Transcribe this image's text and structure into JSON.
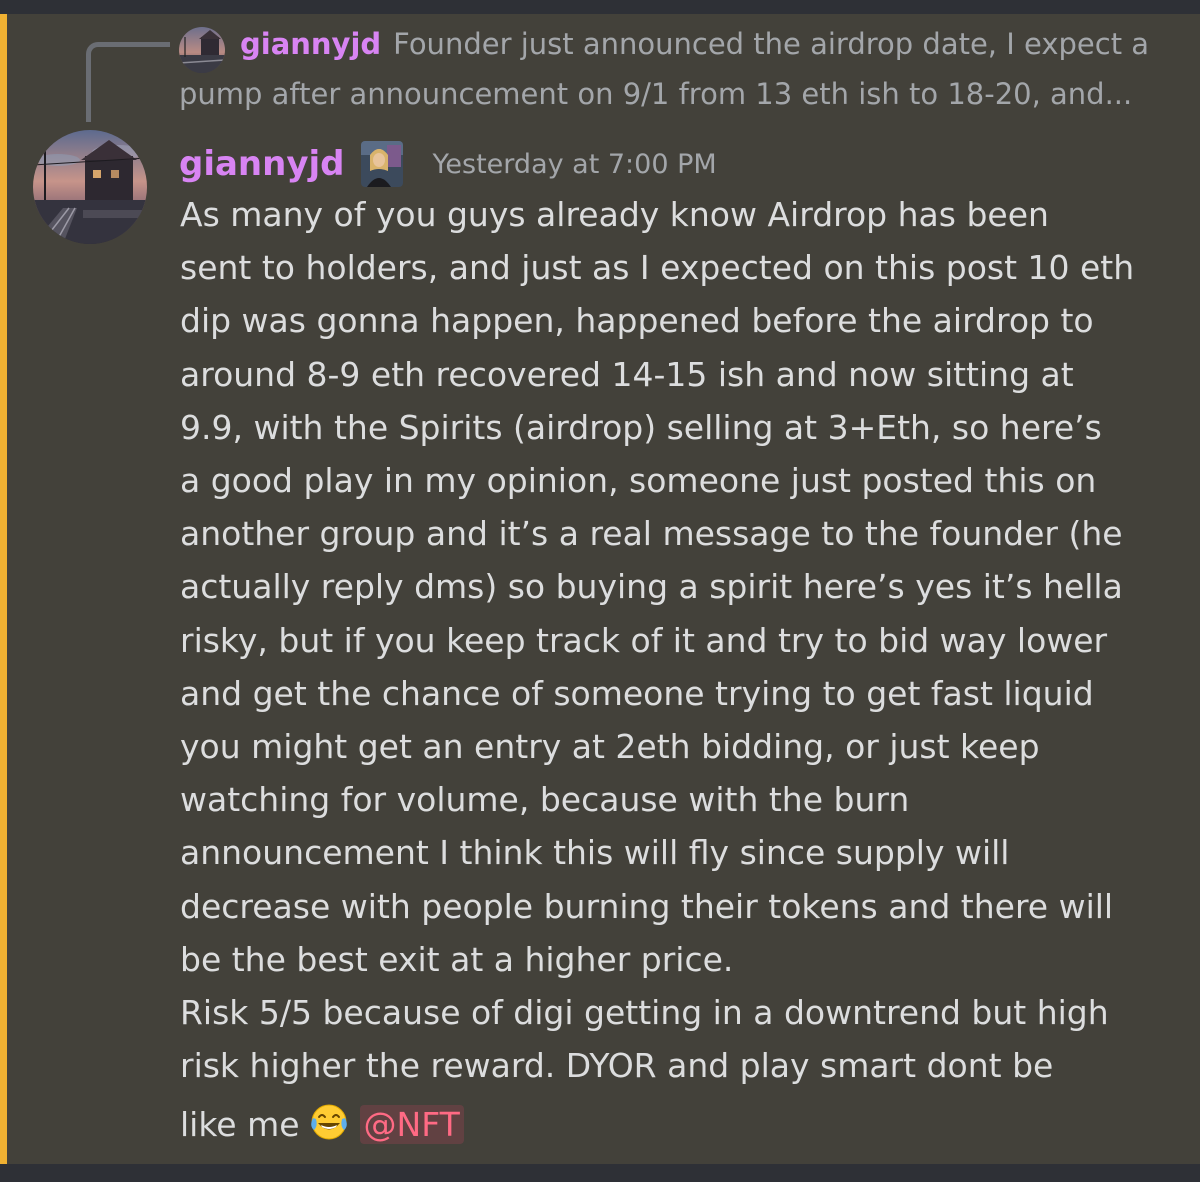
{
  "reply": {
    "author": "giannyjd",
    "preview_line1": "Founder just announced the airdrop date, I expect a",
    "preview_line2": "pump after announcement on 9/1 from 13 eth ish to 18-20, and..."
  },
  "message": {
    "author": "giannyjd",
    "timestamp": "Yesterday at 7:00 PM",
    "lines": [
      "As many of you guys already know Airdrop has been",
      "sent to holders, and just as I expected on this post 10 eth",
      "dip was gonna happen, happened before the airdrop to",
      "around 8-9 eth recovered 14-15 ish and now sitting at",
      "9.9, with the Spirits (airdrop) selling at 3+Eth, so here’s",
      "a good play in my opinion, someone just posted this on",
      "another group and it’s a real message to the founder (he",
      "actually reply dms) so buying a spirit here’s yes it’s hella",
      "risky, but if you keep track of it and try to bid way lower",
      "and get the chance of someone trying to get fast liquid",
      "you might get an entry at 2eth bidding, or just keep",
      "watching for volume, because with the burn",
      "announcement I think this will fly since supply will",
      "decrease with people burning their tokens and there will",
      "be the best exit at a higher price.",
      "Risk 5/5 because of digi getting in a downtrend but high",
      "risk higher the reward. DYOR and play smart dont be"
    ],
    "last_line_text": "like me",
    "emoji": "joy-emoji",
    "mention": "@NFT"
  },
  "colors": {
    "background": "#43413a",
    "highlight_bar": "#f0b132",
    "username": "#d884f3",
    "mention": "#ff6a84",
    "muted_text": "#a3a6aa",
    "body_text": "#dcddde"
  }
}
